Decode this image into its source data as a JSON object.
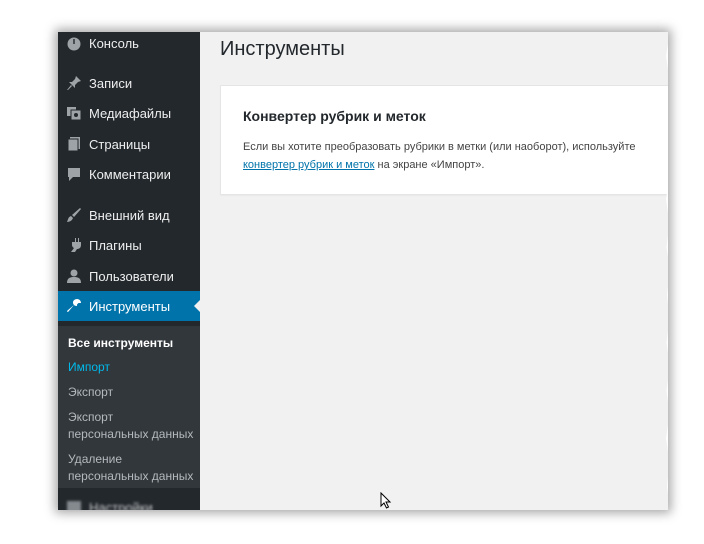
{
  "sidebar": {
    "items": [
      {
        "label": "Консоль",
        "icon": "dashboard-icon"
      },
      {
        "label": "Записи",
        "icon": "pin-icon"
      },
      {
        "label": "Медиафайлы",
        "icon": "media-icon"
      },
      {
        "label": "Страницы",
        "icon": "pages-icon"
      },
      {
        "label": "Комментарии",
        "icon": "comment-icon"
      },
      {
        "label": "Внешний вид",
        "icon": "brush-icon"
      },
      {
        "label": "Плагины",
        "icon": "plugin-icon"
      },
      {
        "label": "Пользователи",
        "icon": "users-icon"
      },
      {
        "label": "Инструменты",
        "icon": "wrench-icon"
      }
    ],
    "submenu": [
      {
        "label": "Все инструменты"
      },
      {
        "label": "Импорт"
      },
      {
        "label": "Экспорт"
      },
      {
        "label": "Экспорт персональных данных"
      },
      {
        "label": "Удаление персональных данных"
      }
    ],
    "settings_label": "Настройки"
  },
  "main": {
    "title": "Инструменты",
    "card": {
      "title": "Конвертер рубрик и меток",
      "text_before": "Если вы хотите преобразовать рубрики в метки (или наоборот), используйте",
      "link_text": "конвертер рубрик и меток",
      "text_after": " на экране «Импорт»."
    }
  },
  "colors": {
    "sidebar_bg": "#23282d",
    "submenu_bg": "#32373c",
    "active_bg": "#0073aa",
    "link": "#0073aa",
    "content_bg": "#f1f1f1"
  }
}
